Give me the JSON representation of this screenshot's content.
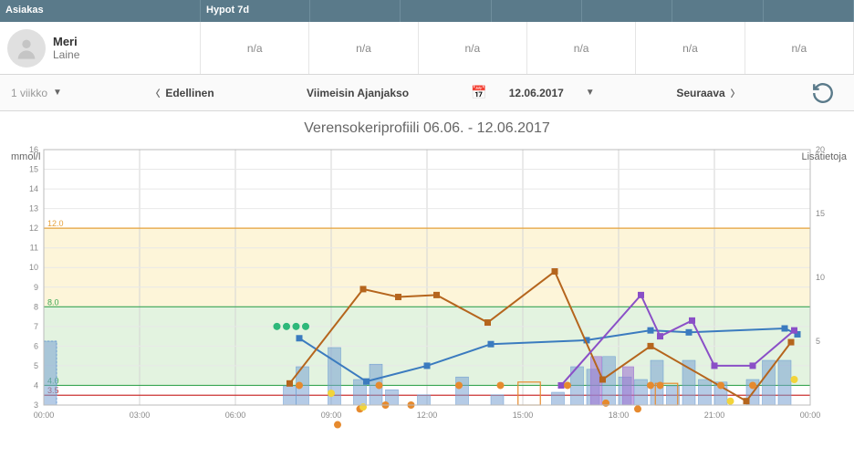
{
  "header": {
    "col1": "Asiakas",
    "col2": "Hypot 7d"
  },
  "patient": {
    "first_name": "Meri",
    "last_name": "Laine"
  },
  "values_row": [
    "n/a",
    "n/a",
    "n/a",
    "n/a",
    "n/a",
    "n/a"
  ],
  "toolbar": {
    "range_label": "1 viikko",
    "prev": "Edellinen",
    "latest": "Viimeisin Ajanjakso",
    "date": "12.06.2017",
    "next": "Seuraava"
  },
  "chart_title": "Verensokeriprofiili 06.06. - 12.06.2017",
  "axes": {
    "left_label": "mmol/l",
    "right_label": "Lisätietoja",
    "left_max": 16,
    "right_max": 20
  },
  "chart_data": {
    "type": "line",
    "x_domain_hours": [
      0,
      24
    ],
    "y_left": {
      "min": 3,
      "max": 16,
      "ticks": [
        3,
        4,
        5,
        6,
        7,
        8,
        9,
        10,
        11,
        12,
        13,
        14,
        15,
        16
      ]
    },
    "y_right": {
      "min": 0,
      "max": 20,
      "ticks": [
        5,
        10,
        15,
        20
      ]
    },
    "x_ticks": [
      "00:00",
      "03:00",
      "06:00",
      "09:00",
      "12:00",
      "15:00",
      "18:00",
      "21:00",
      "00:00"
    ],
    "x_grid_hours": [
      0,
      3,
      6,
      9,
      12,
      15,
      18,
      21,
      24
    ],
    "target_band_green": {
      "low": 4.0,
      "high": 8.0
    },
    "target_band_yellow": {
      "low": 8.0,
      "high": 12.0
    },
    "thresholds": [
      {
        "label": "12.0",
        "y": 12.0,
        "color": "#e6a13a"
      },
      {
        "label": "8.0",
        "y": 8.0,
        "color": "#3aa655"
      },
      {
        "label": "4.0",
        "y": 4.0,
        "color": "#3aa655"
      },
      {
        "label": "3.5",
        "y": 3.5,
        "color": "#cc3333"
      }
    ],
    "series": [
      {
        "name": "blue-line",
        "color": "#3b7bbf",
        "points": [
          {
            "x": 8.0,
            "y": 6.4
          },
          {
            "x": 10.1,
            "y": 4.2
          },
          {
            "x": 12.0,
            "y": 5.0
          },
          {
            "x": 14.0,
            "y": 6.1
          },
          {
            "x": 17.0,
            "y": 6.3
          },
          {
            "x": 19.0,
            "y": 6.8
          },
          {
            "x": 20.2,
            "y": 6.7
          },
          {
            "x": 23.2,
            "y": 6.9
          },
          {
            "x": 23.6,
            "y": 6.6
          }
        ]
      },
      {
        "name": "brown-line",
        "color": "#b5651d",
        "points": [
          {
            "x": 7.7,
            "y": 4.1
          },
          {
            "x": 10.0,
            "y": 8.9
          },
          {
            "x": 11.1,
            "y": 8.5
          },
          {
            "x": 12.3,
            "y": 8.6
          },
          {
            "x": 13.9,
            "y": 7.2
          },
          {
            "x": 16.0,
            "y": 9.8
          },
          {
            "x": 17.5,
            "y": 4.3
          },
          {
            "x": 19.0,
            "y": 6.0
          },
          {
            "x": 22.0,
            "y": 3.2
          },
          {
            "x": 23.4,
            "y": 6.2
          }
        ]
      },
      {
        "name": "purple-line",
        "color": "#8a4fc7",
        "points": [
          {
            "x": 16.2,
            "y": 4.0
          },
          {
            "x": 18.7,
            "y": 8.6
          },
          {
            "x": 19.3,
            "y": 6.5
          },
          {
            "x": 20.3,
            "y": 7.3
          },
          {
            "x": 21.0,
            "y": 5.0
          },
          {
            "x": 22.2,
            "y": 5.0
          },
          {
            "x": 23.5,
            "y": 6.8
          }
        ]
      }
    ],
    "dots_green": [
      {
        "x": 7.3,
        "y": 7.0
      },
      {
        "x": 7.6,
        "y": 7.0
      },
      {
        "x": 7.9,
        "y": 7.0
      },
      {
        "x": 8.2,
        "y": 7.0
      }
    ],
    "dots_orange": [
      {
        "x": 8.0,
        "y": 4.0
      },
      {
        "x": 9.2,
        "y": 2.0
      },
      {
        "x": 9.9,
        "y": 2.8
      },
      {
        "x": 10.5,
        "y": 4.0
      },
      {
        "x": 10.7,
        "y": 3.0
      },
      {
        "x": 11.5,
        "y": 3.0
      },
      {
        "x": 13.0,
        "y": 4.0
      },
      {
        "x": 14.3,
        "y": 4.0
      },
      {
        "x": 16.4,
        "y": 4.0
      },
      {
        "x": 17.6,
        "y": 3.1
      },
      {
        "x": 18.6,
        "y": 2.8
      },
      {
        "x": 19.0,
        "y": 4.0
      },
      {
        "x": 19.3,
        "y": 4.0
      },
      {
        "x": 21.2,
        "y": 4.0
      },
      {
        "x": 22.2,
        "y": 4.0
      }
    ],
    "dots_yellow": [
      {
        "x": 9.0,
        "y": 3.6
      },
      {
        "x": 10.0,
        "y": 2.9
      },
      {
        "x": 21.5,
        "y": 3.2
      },
      {
        "x": 23.5,
        "y": 4.3
      }
    ],
    "bars_blue": [
      {
        "x": 0.2,
        "w": 0.4,
        "h": 5.0
      },
      {
        "x": 7.7,
        "w": 0.4,
        "h": 1.5
      },
      {
        "x": 8.1,
        "w": 0.4,
        "h": 3.0
      },
      {
        "x": 9.1,
        "w": 0.4,
        "h": 4.5
      },
      {
        "x": 9.9,
        "w": 0.4,
        "h": 2.0
      },
      {
        "x": 10.4,
        "w": 0.4,
        "h": 3.2
      },
      {
        "x": 10.9,
        "w": 0.4,
        "h": 1.2
      },
      {
        "x": 11.9,
        "w": 0.4,
        "h": 0.8
      },
      {
        "x": 13.1,
        "w": 0.4,
        "h": 2.2
      },
      {
        "x": 14.2,
        "w": 0.4,
        "h": 0.8
      },
      {
        "x": 16.1,
        "w": 0.4,
        "h": 1.0
      },
      {
        "x": 16.7,
        "w": 0.4,
        "h": 3.0
      },
      {
        "x": 17.2,
        "w": 0.4,
        "h": 2.8
      },
      {
        "x": 17.7,
        "w": 0.4,
        "h": 3.8
      },
      {
        "x": 18.2,
        "w": 0.4,
        "h": 2.2
      },
      {
        "x": 18.7,
        "w": 0.4,
        "h": 2.0
      },
      {
        "x": 19.2,
        "w": 0.4,
        "h": 3.5
      },
      {
        "x": 19.7,
        "w": 0.4,
        "h": 1.5
      },
      {
        "x": 20.2,
        "w": 0.4,
        "h": 3.5
      },
      {
        "x": 20.7,
        "w": 0.4,
        "h": 2.0
      },
      {
        "x": 21.2,
        "w": 0.4,
        "h": 1.8
      },
      {
        "x": 22.2,
        "w": 0.4,
        "h": 2.0
      },
      {
        "x": 22.7,
        "w": 0.4,
        "h": 3.5
      },
      {
        "x": 23.2,
        "w": 0.4,
        "h": 3.5
      }
    ],
    "bars_purple": [
      {
        "x": 17.3,
        "w": 0.35,
        "h": 3.8
      },
      {
        "x": 18.3,
        "w": 0.35,
        "h": 3.0
      }
    ],
    "bar_outline_orange": [
      {
        "x": 15.2,
        "w": 0.7,
        "h": 1.8
      },
      {
        "x": 19.5,
        "w": 0.7,
        "h": 1.7
      }
    ],
    "dashed_bar": {
      "x": 0.2,
      "w": 0.4,
      "h": 5.0
    }
  }
}
